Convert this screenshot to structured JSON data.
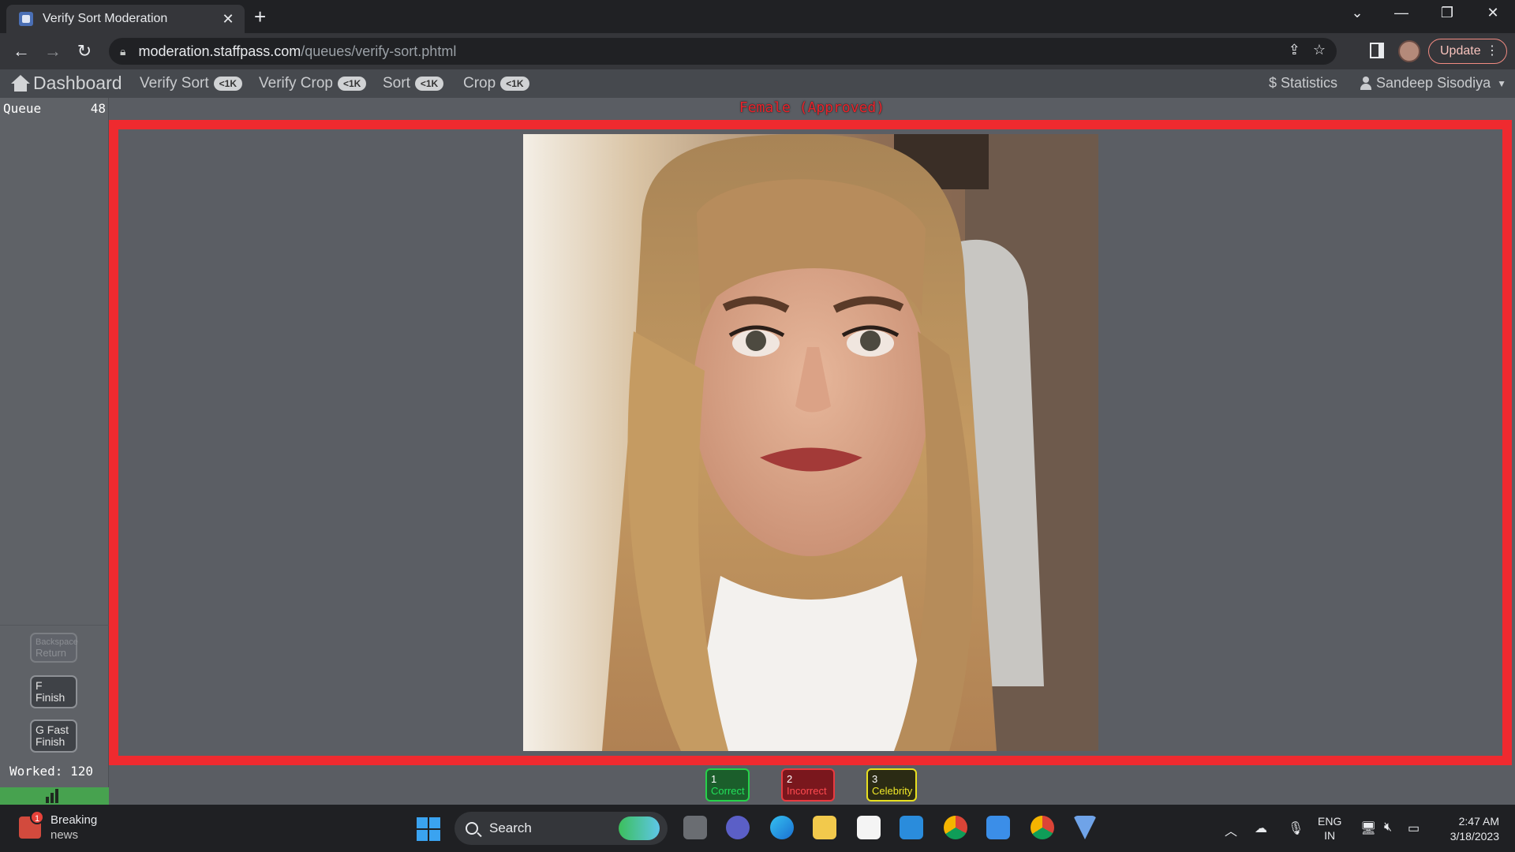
{
  "browser": {
    "tab_title": "Verify Sort Moderation",
    "url_host": "moderation.staffpass.com",
    "url_path": "/queues/verify-sort.phtml",
    "update_label": "Update"
  },
  "appnav": {
    "home_label": "Dashboard",
    "links": [
      {
        "label": "Verify Sort",
        "badge": "<1K"
      },
      {
        "label": "Verify Crop",
        "badge": "<1K"
      },
      {
        "label": "Sort",
        "badge": "<1K"
      },
      {
        "label": "Crop",
        "badge": "<1K"
      }
    ],
    "statistics_label": "$ Statistics",
    "user_name": "Sandeep Sisodiya"
  },
  "sidebar": {
    "queue_label": "Queue",
    "queue_count": "48",
    "buttons": [
      {
        "key": "Backspace",
        "label": "Return"
      },
      {
        "key": "F",
        "label": "Finish"
      },
      {
        "key": "G",
        "label_line1": "Fast",
        "label": "Finish"
      }
    ],
    "worked_label": "Worked: 120"
  },
  "main": {
    "classification": "Female (Approved)",
    "actions": [
      {
        "key": "1",
        "label": "Correct",
        "color": "#22e05a"
      },
      {
        "key": "2",
        "label": "Incorrect",
        "color": "#ff4a50"
      },
      {
        "key": "3",
        "label": "Celebrity",
        "color": "#f0e828"
      }
    ]
  },
  "taskbar": {
    "news_title": "Breaking",
    "news_sub": "news",
    "news_badge": "1",
    "search_label": "Search",
    "lang_line1": "ENG",
    "lang_line2": "IN",
    "time": "2:47 AM",
    "date": "3/18/2023"
  },
  "colors": {
    "accent_frame": "#ef2a2f",
    "chrome_bg": "#202124",
    "nav_bg": "#46494e"
  }
}
